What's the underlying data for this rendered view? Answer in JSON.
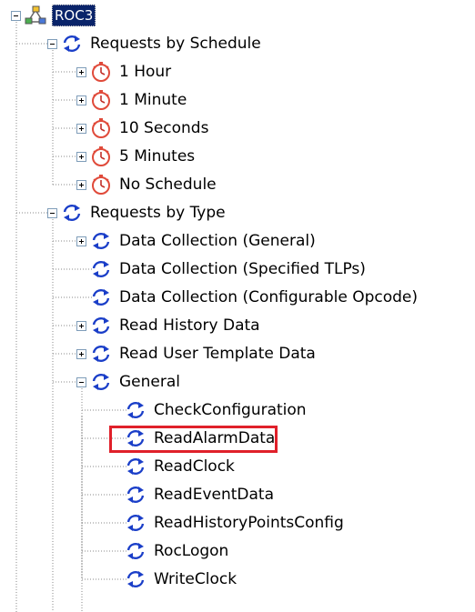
{
  "tree": {
    "root": {
      "label": "ROC3",
      "icon": "network-icon",
      "expanded": true,
      "selected": true
    },
    "groups": [
      {
        "label": "Requests by Schedule",
        "icon": "refresh-icon",
        "expanded": true,
        "children": [
          {
            "label": "1 Hour",
            "icon": "timer-icon",
            "expandable": true
          },
          {
            "label": "1 Minute",
            "icon": "timer-icon",
            "expandable": true
          },
          {
            "label": "10 Seconds",
            "icon": "timer-icon",
            "expandable": true
          },
          {
            "label": "5 Minutes",
            "icon": "timer-icon",
            "expandable": true
          },
          {
            "label": "No Schedule",
            "icon": "timer-icon",
            "expandable": true
          }
        ]
      },
      {
        "label": "Requests by Type",
        "icon": "refresh-icon",
        "expanded": true,
        "children": [
          {
            "label": "Data Collection (General)",
            "icon": "refresh-icon",
            "expandable": true
          },
          {
            "label": "Data Collection (Specified TLPs)",
            "icon": "refresh-icon",
            "expandable": false
          },
          {
            "label": "Data Collection (Configurable Opcode)",
            "icon": "refresh-icon",
            "expandable": false
          },
          {
            "label": "Read History Data",
            "icon": "refresh-icon",
            "expandable": true
          },
          {
            "label": "Read User Template Data",
            "icon": "refresh-icon",
            "expandable": true
          },
          {
            "label": "General",
            "icon": "refresh-icon",
            "expanded": true,
            "children": [
              {
                "label": "CheckConfiguration",
                "icon": "refresh-icon"
              },
              {
                "label": "ReadAlarmData",
                "icon": "refresh-icon",
                "highlighted": true
              },
              {
                "label": "ReadClock",
                "icon": "refresh-icon"
              },
              {
                "label": "ReadEventData",
                "icon": "refresh-icon"
              },
              {
                "label": "ReadHistoryPointsConfig",
                "icon": "refresh-icon"
              },
              {
                "label": "RocLogon",
                "icon": "refresh-icon"
              },
              {
                "label": "WriteClock",
                "icon": "refresh-icon"
              }
            ]
          }
        ]
      }
    ]
  },
  "colors": {
    "selection_bg": "#0a246a",
    "highlight_border": "#e0202a",
    "refresh_icon": "#1a3ec8",
    "timer_icon": "#e04a3a",
    "tree_line": "#8a8a8a"
  }
}
